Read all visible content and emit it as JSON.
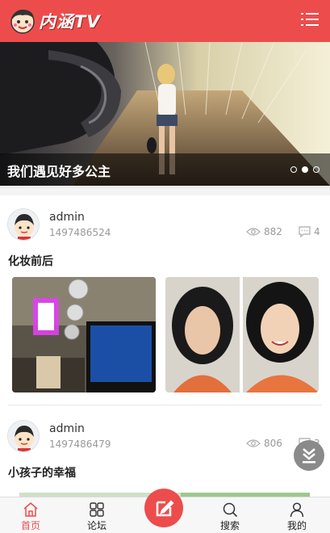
{
  "header": {
    "logo_text": "内涵TV",
    "logo_icon": "cartoon-boy-logo",
    "menu_icon": "list-menu-icon",
    "accent_color": "#ed4c4c"
  },
  "banner": {
    "caption": "我们遇见好多公主",
    "slides_total": 3,
    "active_slide": 2
  },
  "posts": [
    {
      "author": "admin",
      "timestamp": "1497486524",
      "views": "882",
      "comments": "4",
      "title": "化妆前后"
    },
    {
      "author": "admin",
      "timestamp": "1497486479",
      "views": "806",
      "comments": "3",
      "title": "小孩子的幸福"
    }
  ],
  "bottom_nav": {
    "items": [
      {
        "label": "首页",
        "icon": "home-icon",
        "active": true
      },
      {
        "label": "论坛",
        "icon": "grid-icon",
        "active": false
      },
      {
        "label": "",
        "icon": "edit-icon",
        "active": false
      },
      {
        "label": "搜索",
        "icon": "search-icon",
        "active": false
      },
      {
        "label": "我的",
        "icon": "user-icon",
        "active": false
      }
    ]
  }
}
